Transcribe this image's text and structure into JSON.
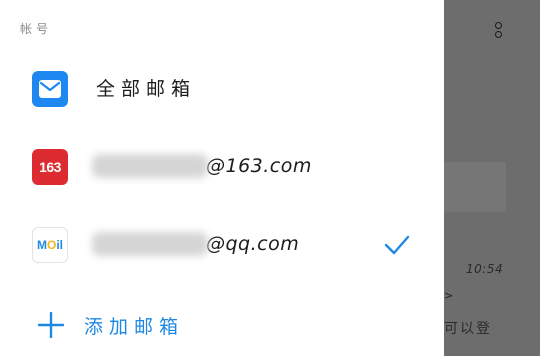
{
  "drawer": {
    "section_label": "帐号",
    "all_mailboxes": {
      "label": "全部邮箱",
      "icon": "mail-envelope-icon"
    },
    "accounts": [
      {
        "icon_text": "163",
        "domain": "@163.com",
        "selected": false
      },
      {
        "icon_text": "MOil",
        "domain": "@qq.com",
        "selected": true
      }
    ],
    "add_mailbox": {
      "label": "添加邮箱",
      "icon": "plus-icon"
    }
  },
  "background": {
    "time": "10:54",
    "chevron": ">",
    "snippet": "可以登"
  },
  "colors": {
    "accent": "#1e88e5",
    "icon_163": "#dc2c32",
    "icon_all": "#1e88f0",
    "scrim": "#6d6d6d"
  }
}
